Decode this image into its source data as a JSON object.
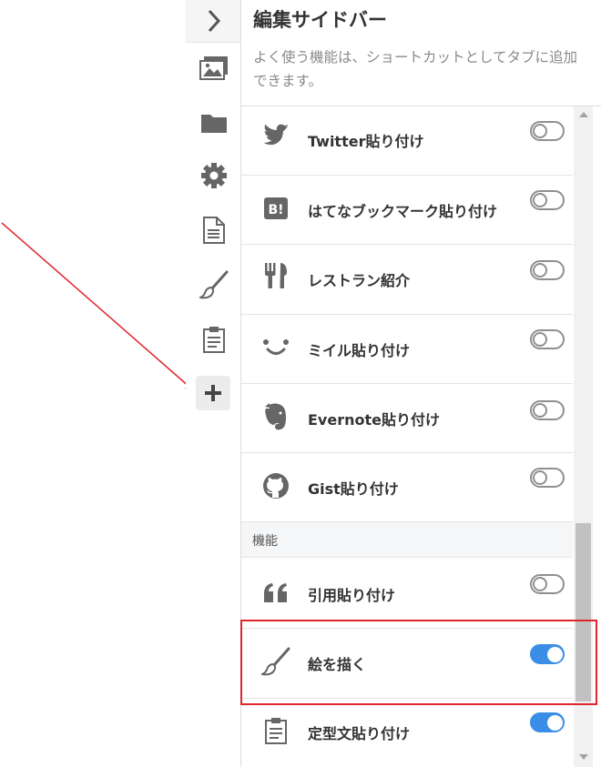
{
  "panel": {
    "title": "編集サイドバー",
    "description": "よく使う機能は、ショートカットとしてタブに追加できます。"
  },
  "rail": {
    "items": [
      {
        "icon": "chevron-right-icon"
      },
      {
        "icon": "image-icon"
      },
      {
        "icon": "folder-icon"
      },
      {
        "icon": "gear-icon"
      },
      {
        "icon": "document-icon"
      },
      {
        "icon": "brush-icon"
      },
      {
        "icon": "clipboard-icon"
      },
      {
        "icon": "plus-icon"
      }
    ]
  },
  "list": {
    "items": [
      {
        "label": "Twitter貼り付け",
        "icon": "twitter-icon",
        "enabled": false
      },
      {
        "label": "はてなブックマーク貼り付け",
        "icon": "hatena-bookmark-icon",
        "enabled": false
      },
      {
        "label": "レストラン紹介",
        "icon": "restaurant-icon",
        "enabled": false
      },
      {
        "label": "ミイル貼り付け",
        "icon": "smile-icon",
        "enabled": false
      },
      {
        "label": "Evernote貼り付け",
        "icon": "evernote-icon",
        "enabled": false
      },
      {
        "label": "Gist貼り付け",
        "icon": "github-icon",
        "enabled": false
      }
    ],
    "section": "機能",
    "feature_items": [
      {
        "label": "引用貼り付け",
        "icon": "quote-icon",
        "enabled": false
      },
      {
        "label": "絵を描く",
        "icon": "brush-icon",
        "enabled": true
      },
      {
        "label": "定型文貼り付け",
        "icon": "clipboard-icon",
        "enabled": true
      }
    ]
  },
  "colors": {
    "toggle_on": "#3a8ee6",
    "toggle_off": "#8f8f8f",
    "highlight": "#e0252b",
    "icon": "#666666"
  }
}
